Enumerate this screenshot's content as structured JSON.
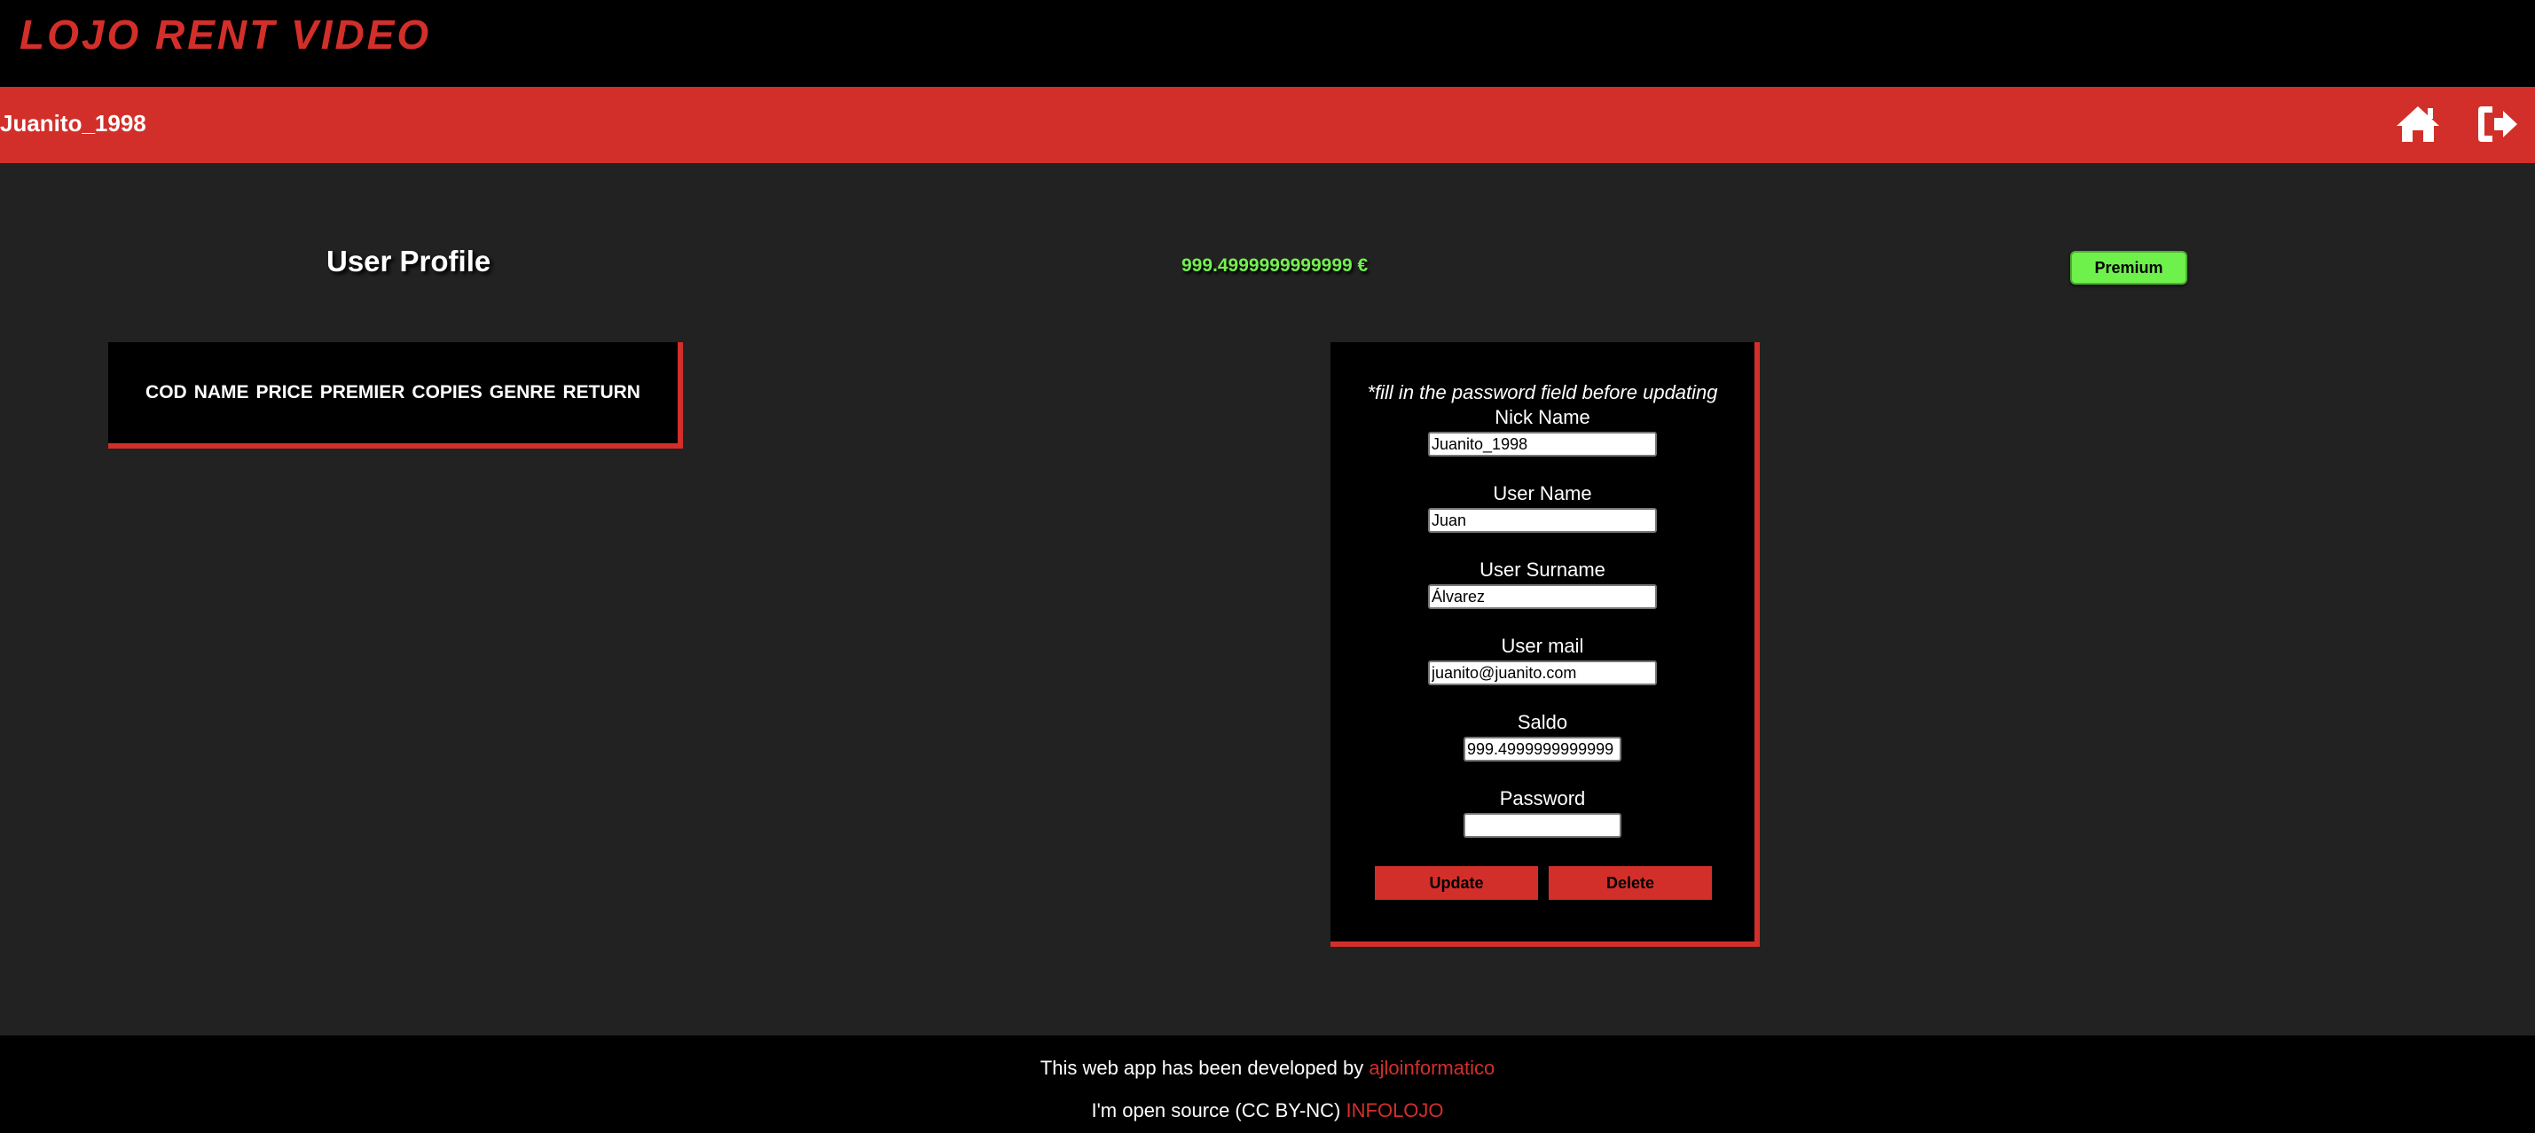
{
  "brand": {
    "title": "LOJO RENT VIDEO"
  },
  "navbar": {
    "username": "Juanito_1998",
    "icons": {
      "home": "home-icon",
      "logout": "logout-icon"
    }
  },
  "profile": {
    "title": "User Profile",
    "balance": "999.4999999999999 €",
    "premium_label": "Premium"
  },
  "movies_table": {
    "columns": [
      "COD",
      "NAME",
      "PRICE",
      "PREMIER",
      "COPIES",
      "GENRE",
      "RETURN"
    ]
  },
  "form": {
    "note": "*fill in the password field before updating",
    "fields": [
      {
        "label": "Nick Name",
        "value": "Juanito_1998"
      },
      {
        "label": "User Name",
        "value": "Juan"
      },
      {
        "label": "User Surname",
        "value": "Álvarez"
      },
      {
        "label": "User mail",
        "value": "juanito@juanito.com"
      },
      {
        "label": "Saldo",
        "value": "999.4999999999999"
      },
      {
        "label": "Password",
        "value": ""
      }
    ],
    "update_label": "Update",
    "delete_label": "Delete"
  },
  "footer": {
    "line1_text": "This web app has been developed by",
    "line1_link": "ajloinformatico",
    "line2_text": "I'm open source (CC BY-NC)",
    "line2_link": "INFOLOJO"
  },
  "colors": {
    "accent": "#d32f2a",
    "premium": "#6ff14c",
    "balance": "#74f04f",
    "background": "#222222"
  }
}
